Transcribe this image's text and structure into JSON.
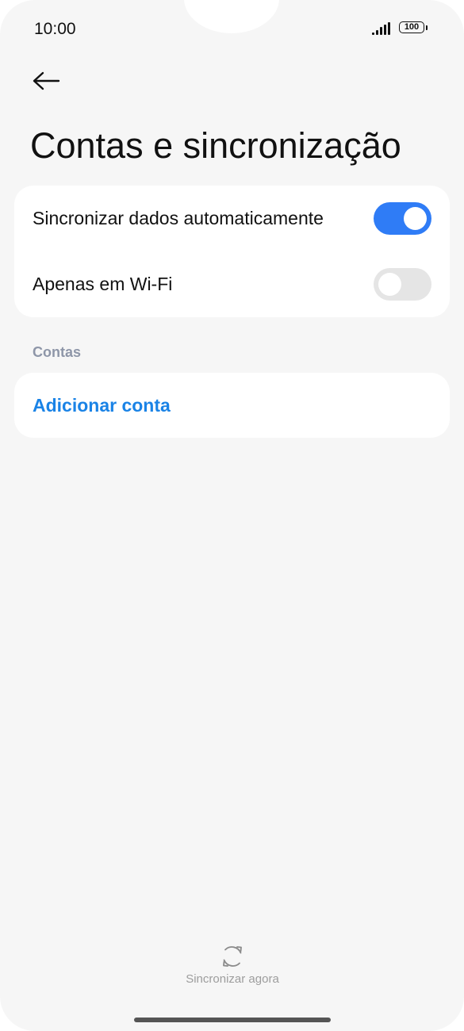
{
  "status_bar": {
    "time": "10:00",
    "battery": "100",
    "signal_icon": "signal-bars-icon",
    "battery_icon": "battery-icon"
  },
  "header": {
    "back_icon": "arrow-left-icon",
    "title": "Contas e sincronização"
  },
  "sync_settings": {
    "auto_sync": {
      "label": "Sincronizar dados automaticamente",
      "enabled": true
    },
    "wifi_only": {
      "label": "Apenas em Wi-Fi",
      "enabled": false
    }
  },
  "accounts_section": {
    "header": "Contas",
    "add_account": "Adicionar conta"
  },
  "footer": {
    "sync_now_icon": "sync-icon",
    "sync_now_label": "Sincronizar agora"
  },
  "colors": {
    "accent": "#2f7cf6",
    "link": "#1a83e6",
    "background": "#f6f6f6",
    "card": "#ffffff",
    "toggle_off": "#e5e5e5",
    "section_header": "#8e96a8"
  }
}
